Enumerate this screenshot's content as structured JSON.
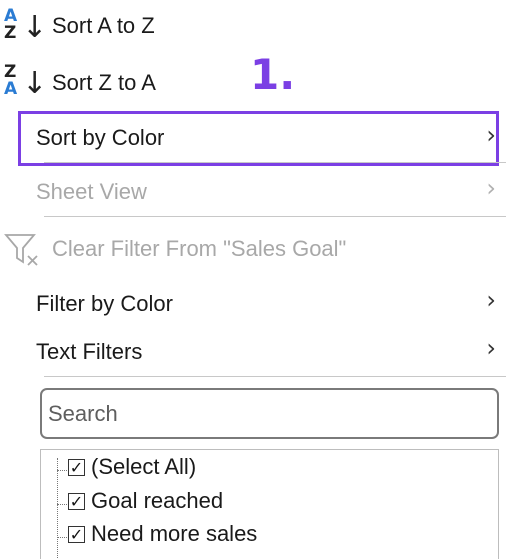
{
  "menu": {
    "sort_az": {
      "label": "Sort A to Z",
      "icon": "sort-a-to-z-icon",
      "glyph_top": "A",
      "glyph_bottom": "Z"
    },
    "sort_za": {
      "label": "Sort Z to A",
      "icon": "sort-z-to-a-icon",
      "glyph_top": "Z",
      "glyph_bottom": "A"
    },
    "sort_by_color": {
      "label": "Sort by Color",
      "has_submenu": true
    },
    "sheet_view": {
      "label": "Sheet View",
      "has_submenu": true,
      "disabled": true
    },
    "clear_filter": {
      "label": "Clear Filter From \"Sales Goal\"",
      "icon": "clear-filter-icon",
      "disabled": true
    },
    "filter_by_color": {
      "label": "Filter by Color",
      "has_submenu": true
    },
    "text_filters": {
      "label": "Text Filters",
      "has_submenu": true
    }
  },
  "annotation": {
    "step_label": "1.",
    "color": "#7b3fe4"
  },
  "search": {
    "placeholder": "Search",
    "value": ""
  },
  "filter_list": {
    "items": [
      {
        "label": "(Select All)",
        "checked": true
      },
      {
        "label": "Goal reached",
        "checked": true
      },
      {
        "label": "Need more sales",
        "checked": true
      }
    ]
  },
  "colors": {
    "accent_blue": "#2b7cd3",
    "disabled_text": "#a8a8a8",
    "highlight": "#7b3fe4"
  }
}
